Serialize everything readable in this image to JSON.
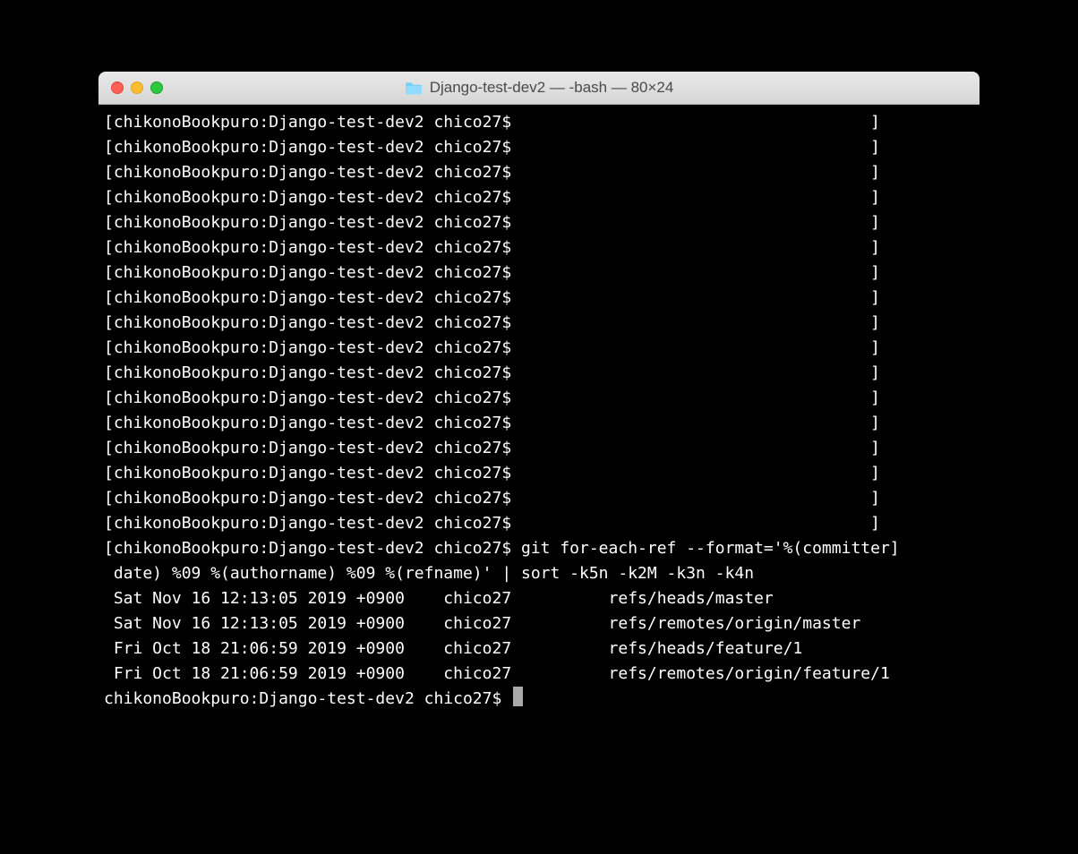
{
  "window": {
    "title": "Django-test-dev2 — -bash — 80×24",
    "traffic_lights": [
      "close",
      "minimize",
      "zoom"
    ]
  },
  "terminal": {
    "prompt": "chikonoBookpuro:Django-test-dev2 chico27$",
    "empty_prompt_line": "[chikonoBookpuro:Django-test-dev2 chico27$                                     ]",
    "empty_prompt_count": 17,
    "command_line_1": "[chikonoBookpuro:Django-test-dev2 chico27$ git for-each-ref --format='%(committer]",
    "command_line_2": " date) %09 %(authorname) %09 %(refname)' | sort -k5n -k2M -k3n -k4n",
    "output": [
      " Sat Nov 16 12:13:05 2019 +0900    chico27          refs/heads/master",
      " Sat Nov 16 12:13:05 2019 +0900    chico27          refs/remotes/origin/master",
      " Fri Oct 18 21:06:59 2019 +0900    chico27          refs/heads/feature/1",
      " Fri Oct 18 21:06:59 2019 +0900    chico27          refs/remotes/origin/feature/1"
    ],
    "final_prompt": "chikonoBookpuro:Django-test-dev2 chico27$ "
  }
}
